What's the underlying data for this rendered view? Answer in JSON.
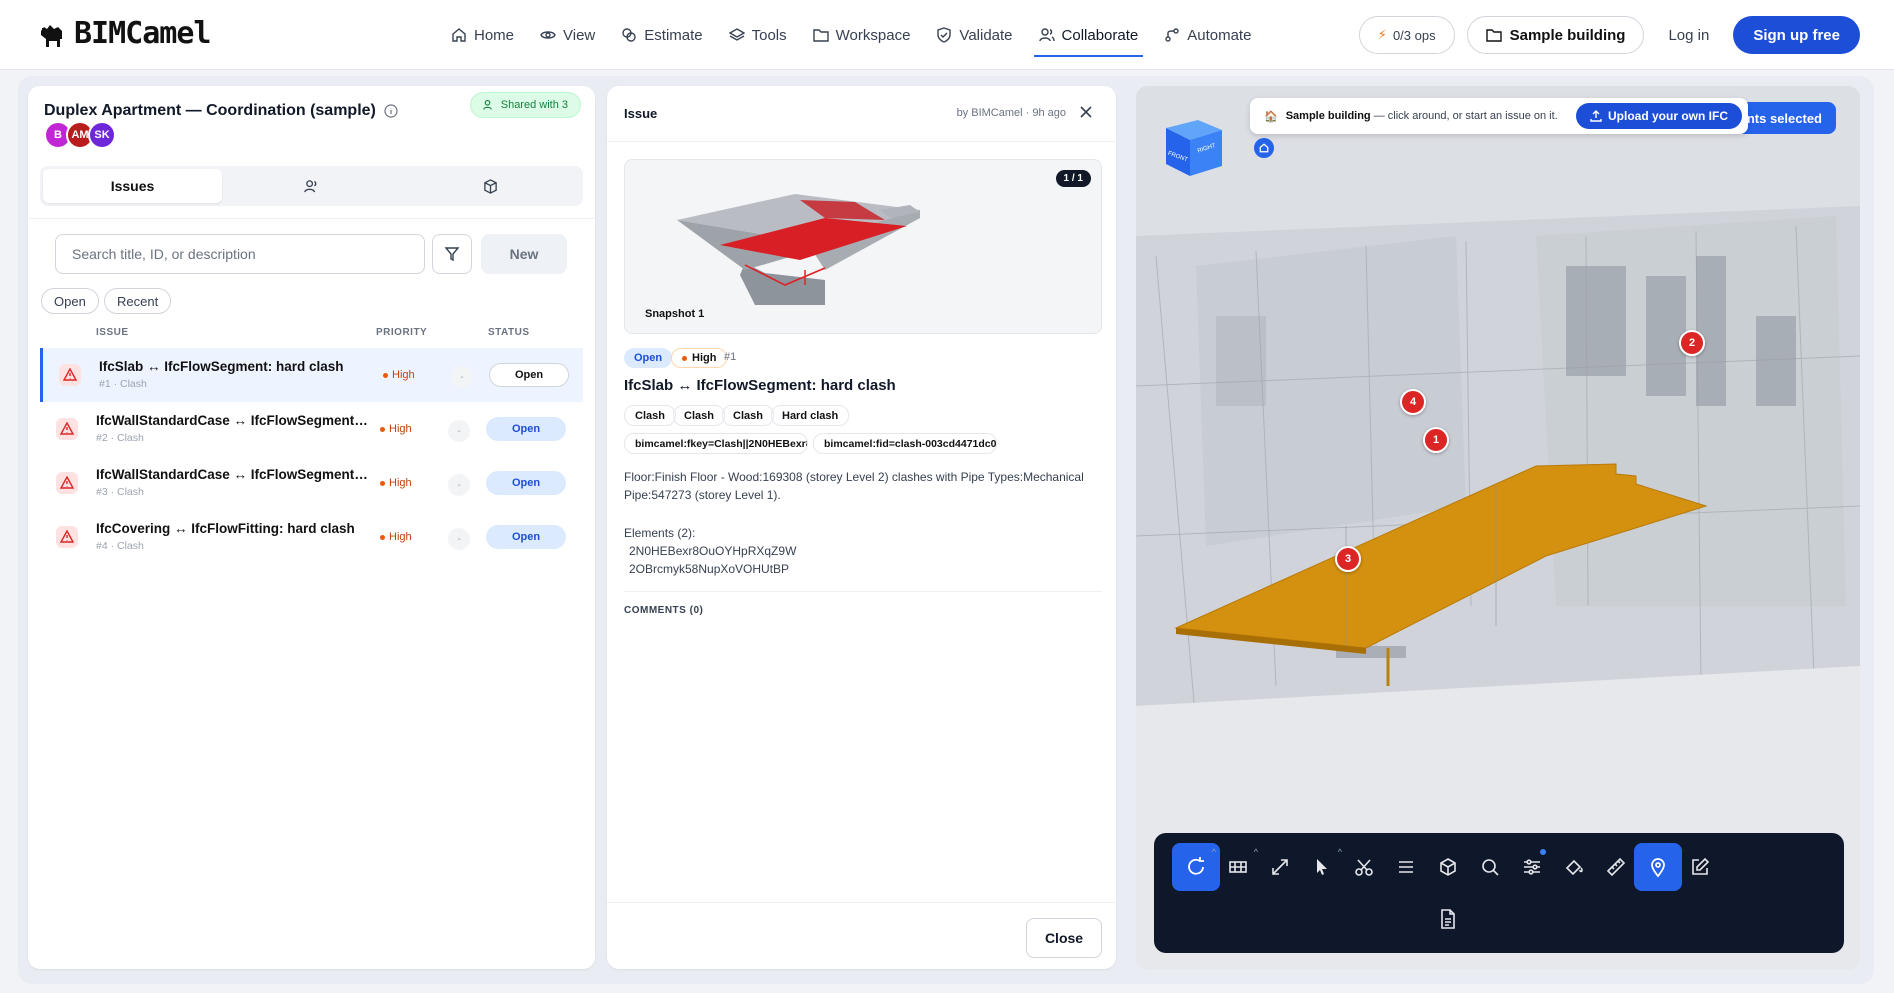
{
  "brand": {
    "name": "BIMCamel"
  },
  "nav": {
    "items": [
      {
        "label": "Home",
        "icon": "home-icon"
      },
      {
        "label": "View",
        "icon": "eye-icon"
      },
      {
        "label": "Estimate",
        "icon": "coins-icon"
      },
      {
        "label": "Tools",
        "icon": "layers-icon"
      },
      {
        "label": "Workspace",
        "icon": "folder-icon"
      },
      {
        "label": "Validate",
        "icon": "shield-check-icon"
      },
      {
        "label": "Collaborate",
        "icon": "users-icon",
        "active": true
      },
      {
        "label": "Automate",
        "icon": "workflow-icon"
      }
    ],
    "ops": "0/3 ops",
    "sample": "Sample building",
    "login": "Log in",
    "signup": "Sign up free"
  },
  "issues_panel": {
    "title": "Duplex Apartment — Coordination (sample)",
    "shared": "Shared with 3",
    "avatars": [
      {
        "initials": "B",
        "color": "#c026d3"
      },
      {
        "initials": "AM",
        "color": "#b91c1c"
      },
      {
        "initials": "SK",
        "color": "#6d28d9"
      }
    ],
    "tabs": [
      {
        "label": "Issues"
      }
    ],
    "search_placeholder": "Search title, ID, or description",
    "new_label": "New",
    "filters": [
      "Open",
      "Recent"
    ],
    "columns": {
      "issue": "ISSUE",
      "priority": "PRIORITY",
      "status": "STATUS"
    },
    "rows": [
      {
        "title": "IfcSlab ↔ IfcFlowSegment: hard clash",
        "sub": "#1 · Clash",
        "priority": "High",
        "dash": "-",
        "status": "Open",
        "selected": true
      },
      {
        "title": "IfcWallStandardCase ↔ IfcFlowSegment: hard clash",
        "sub": "#2 · Clash",
        "priority": "High",
        "dash": "-",
        "status": "Open"
      },
      {
        "title": "IfcWallStandardCase ↔ IfcFlowSegment: hard clash",
        "sub": "#3 · Clash",
        "priority": "High",
        "dash": "-",
        "status": "Open"
      },
      {
        "title": "IfcCovering ↔ IfcFlowFitting: hard clash",
        "sub": "#4 · Clash",
        "priority": "High",
        "dash": "-",
        "status": "Open"
      }
    ]
  },
  "issue_detail": {
    "header": "Issue",
    "by": "by BIMCamel · 9h ago",
    "snapshot_count": "1 / 1",
    "snapshot_label": "Snapshot 1",
    "status": "Open",
    "priority": "High",
    "number": "#1",
    "title": "IfcSlab ↔ IfcFlowSegment: hard clash",
    "tags": [
      "Clash",
      "Clash",
      "Clash",
      "Hard clash"
    ],
    "keys": [
      "bimcamel:fkey=Clash||2N0HEBexr8...",
      "bimcamel:fid=clash-003cd4471dc0..."
    ],
    "description": "Floor:Finish Floor - Wood:169308 (storey Level 2) clashes with Pipe Types:Mechanical Pipe:547273 (storey Level 1).",
    "elements_label": "Elements (2):",
    "elements": [
      "2N0HEBexr8OuOYHpRXqZ9W",
      "2OBrcmyk58NupXoVOHUtBP"
    ],
    "comments": "COMMENTS (0)",
    "close": "Close"
  },
  "viewer": {
    "banner_title": "Sample building",
    "banner_text": "— click around, or start an issue on it.",
    "upload": "Upload your own IFC",
    "selected": "ments selected",
    "cube_front": "FRONT",
    "cube_right": "RIGHT",
    "pins": [
      "1",
      "2",
      "3",
      "4"
    ],
    "slab_color": "#d4900f",
    "toolbar": [
      "orbit-icon",
      "storey-icon",
      "fit-icon",
      "select-icon",
      "cut-icon",
      "list-icon",
      "box-icon",
      "search-icon",
      "sliders-icon",
      "paint-icon",
      "measure-icon",
      "pin-icon",
      "edit-icon",
      "document-icon"
    ]
  }
}
